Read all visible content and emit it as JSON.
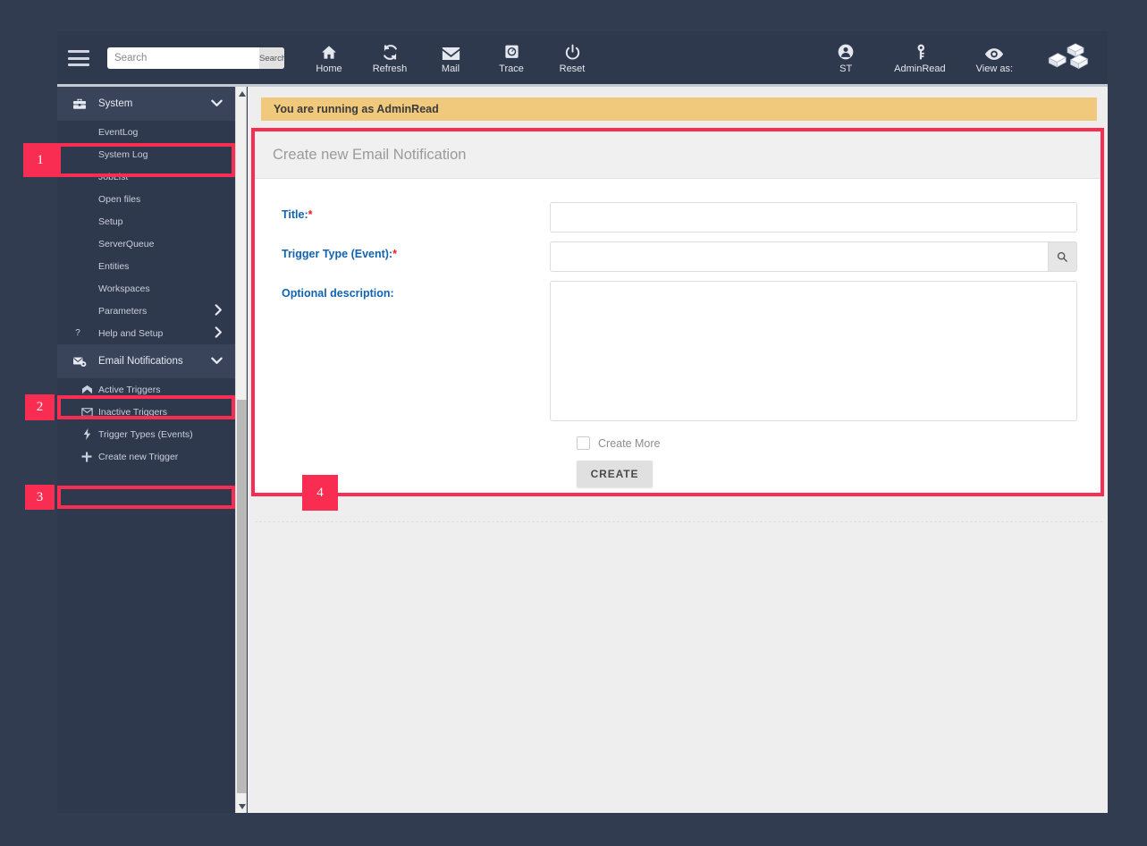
{
  "topbar": {
    "menu_icon": "hamburger-icon",
    "search": {
      "value": "",
      "placeholder": "Search",
      "button_label": "Search"
    },
    "nav": [
      {
        "label": "Home",
        "icon": "home-icon"
      },
      {
        "label": "Refresh",
        "icon": "refresh-icon"
      },
      {
        "label": "Mail",
        "icon": "mail-icon"
      },
      {
        "label": "Trace",
        "icon": "trace-icon"
      },
      {
        "label": "Reset",
        "icon": "power-icon"
      }
    ],
    "right_nav": [
      {
        "label": "ST",
        "icon": "user-icon"
      },
      {
        "label": "AdminRead",
        "icon": "key-icon"
      },
      {
        "label": "View as:",
        "icon": "eye-icon"
      }
    ],
    "logo": "isometric-cube-logo"
  },
  "sidebar": {
    "sections": [
      {
        "type": "head",
        "label": "System",
        "icon": "toolbox-icon",
        "chevron": "⌄",
        "expanded": true
      },
      {
        "type": "sub",
        "label": "EventLog"
      },
      {
        "type": "sub",
        "label": "System Log"
      },
      {
        "type": "sub",
        "label": "JobList"
      },
      {
        "type": "sub",
        "label": "Open files"
      },
      {
        "type": "sub",
        "label": "Setup"
      },
      {
        "type": "sub",
        "label": "ServerQueue"
      },
      {
        "type": "sub",
        "label": "Entities"
      },
      {
        "type": "sub",
        "label": "Workspaces"
      },
      {
        "type": "sub",
        "label": "Parameters",
        "arrow": "›"
      },
      {
        "type": "sub",
        "label": "Help and Setup",
        "icon": "question-icon",
        "arrow": "›"
      },
      {
        "type": "head",
        "label": "Email Notifications",
        "icon": "mail-gear-icon",
        "chevron": "⌄",
        "expanded": true
      },
      {
        "type": "sub",
        "label": "Active Triggers",
        "icon": "envelope-open-icon"
      },
      {
        "type": "sub",
        "label": "Inactive Triggers",
        "icon": "envelope-icon"
      },
      {
        "type": "sub",
        "label": "Trigger Types (Events)",
        "icon": "bolt-icon"
      },
      {
        "type": "sub",
        "label": "Create new Trigger",
        "icon": "plus-icon"
      }
    ]
  },
  "content": {
    "alert": "You are running as AdminRead",
    "card_title": "Create new Email Notification",
    "fields": {
      "title": {
        "label": "Title:",
        "required_mark": "*",
        "value": "",
        "placeholder": ""
      },
      "trigger_type": {
        "label": "Trigger Type (Event):",
        "required_mark": "*",
        "value": "",
        "placeholder": "",
        "lookup_icon": "search-icon"
      },
      "description": {
        "label": "Optional description:",
        "required_mark": "",
        "value": "",
        "placeholder": ""
      }
    },
    "create_more": {
      "label": "Create More",
      "checked": false
    },
    "create_button": "CREATE"
  },
  "annotations": {
    "badges": [
      {
        "n": "1"
      },
      {
        "n": "2"
      },
      {
        "n": "3"
      },
      {
        "n": "4"
      }
    ],
    "accent_color": "#f92c52"
  }
}
